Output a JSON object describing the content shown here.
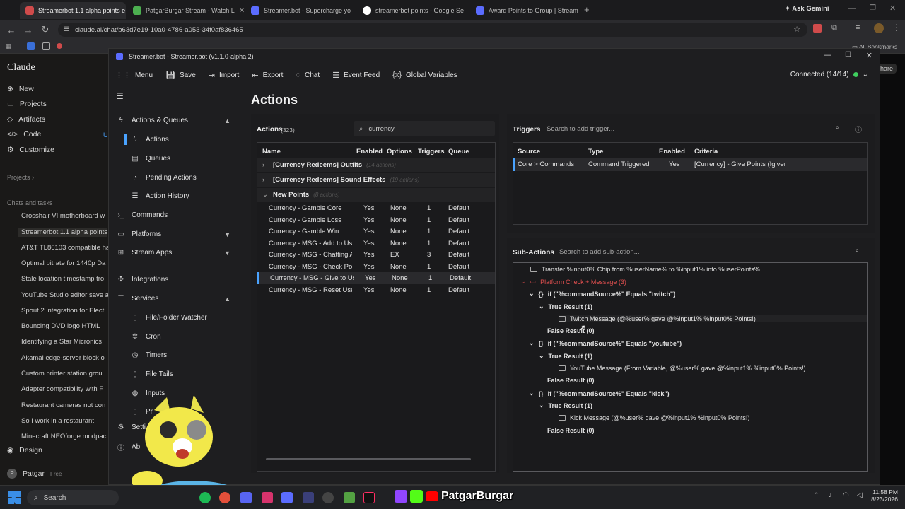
{
  "browser": {
    "tabs": [
      {
        "title": "Streamerbot 1.1 alpha points e"
      },
      {
        "title": "PatgarBurgar Stream - Watch L"
      },
      {
        "title": "Streamer.bot - Supercharge yo"
      },
      {
        "title": "streamerbot points - Google Se"
      },
      {
        "title": "Award Points to Group | Stream"
      }
    ],
    "ask_gemini": "Ask Gemini",
    "url": "claude.ai/chat/b63d7e19-10a0-4786-a053-34f0af836465",
    "all_bookmarks": "All Bookmarks"
  },
  "claude": {
    "brand": "Claude",
    "nav": {
      "new": "New",
      "projects": "Projects",
      "artifacts": "Artifacts",
      "code": "Code",
      "customize": "Customize"
    },
    "projects_header": "Projects",
    "chats_header": "Chats and tasks",
    "chats": [
      "Crosshair VI motherboard w",
      "Streamerbot 1.1 alpha points",
      "AT&T TL86103 compatible ha",
      "Optimal bitrate for 1440p Da",
      "Stale location timestamp tro",
      "YouTube Studio editor save a",
      "Spout 2 integration for Elect",
      "Bouncing DVD logo HTML",
      "Identifying a Star Micronics",
      "Akamai edge-server block o",
      "Custom printer station grou",
      "Adapter compatibility with F",
      "Restaurant cameras not con",
      "So I work in a restaurant",
      "Minecraft NEOforge modpac"
    ],
    "design": "Design",
    "user": "Patgar",
    "plan": "Free",
    "share": "hare",
    "code_badge": "U"
  },
  "sb": {
    "window_title": "Streamer.bot - Streamer.bot (v1.1.0-alpha.2)",
    "menu": {
      "menu": "Menu",
      "save": "Save",
      "import": "Import",
      "export": "Export",
      "chat": "Chat",
      "event_feed": "Event Feed",
      "global_vars": "Global Variables"
    },
    "connected": "Connected (14/14)",
    "nav": {
      "actions_queues": "Actions & Queues",
      "actions": "Actions",
      "queues": "Queues",
      "pending": "Pending Actions",
      "history": "Action History",
      "commands": "Commands",
      "platforms": "Platforms",
      "stream_apps": "Stream Apps",
      "integrations": "Integrations",
      "services": "Services",
      "file_watcher": "File/Folder Watcher",
      "cron": "Cron",
      "timers": "Timers",
      "file_tails": "File Tails",
      "inputs": "Inputs",
      "pr": "Pr",
      "settings": "Setti",
      "about": "Ab"
    },
    "page_title": "Actions",
    "actions": {
      "label": "Actions",
      "count": "(323)",
      "search_value": "currency",
      "columns": [
        "Name",
        "Enabled",
        "Options",
        "Triggers",
        "Queue"
      ],
      "groups": [
        {
          "name": "[Currency Redeems] Outfits",
          "count": "(14 actions)"
        },
        {
          "name": "[Currency Redeems] Sound Effects",
          "count": "(19 actions)"
        },
        {
          "name": "New Points",
          "count": "(8 actions)"
        }
      ],
      "rows": [
        [
          "Currency - Gamble Core",
          "Yes",
          "None",
          "1",
          "Default"
        ],
        [
          "Currency - Gamble Loss",
          "Yes",
          "None",
          "1",
          "Default"
        ],
        [
          "Currency - Gamble Win",
          "Yes",
          "None",
          "1",
          "Default"
        ],
        [
          "Currency - MSG - Add to Us",
          "Yes",
          "None",
          "1",
          "Default"
        ],
        [
          "Currency - MSG - Chatting A",
          "Yes",
          "EX",
          "3",
          "Default"
        ],
        [
          "Currency - MSG - Check Poi",
          "Yes",
          "None",
          "1",
          "Default"
        ],
        [
          "Currency - MSG - Give to Us",
          "Yes",
          "None",
          "1",
          "Default"
        ],
        [
          "Currency - MSG - Reset Use",
          "Yes",
          "None",
          "1",
          "Default"
        ]
      ]
    },
    "triggers": {
      "label": "Triggers",
      "search_placeholder": "Search to add trigger...",
      "columns": [
        "Source",
        "Type",
        "Enabled",
        "Criteria"
      ],
      "rows": [
        [
          "Core > Commands",
          "Command Triggered",
          "Yes",
          "[Currency] - Give Points (!giver"
        ]
      ]
    },
    "subactions": {
      "label": "Sub-Actions",
      "search_placeholder": "Search to add sub-action...",
      "items": [
        "Transfer %input0% Chip from %userName% to %input1% into %userPoints%",
        "Platform Check + Message (3)",
        "if (\"%commandSource%\" Equals \"twitch\")",
        "True Result (1)",
        "Twitch Message (@%user% gave @%input1% %input0% Points!)",
        "False Result (0)",
        "if (\"%commandSource%\" Equals \"youtube\")",
        "True Result (1)",
        "YouTube Message (From Variable, @%user% gave @%input1% %input0% Points!)",
        "False Result (0)",
        "if (\"%commandSource%\" Equals \"kick\")",
        "True Result (1)",
        "Kick Message (@%user% gave @%input1% %input0% Points!)",
        "False Result (0)"
      ]
    }
  },
  "taskbar": {
    "search": "Search",
    "streamer_name": "PatgarBurgar",
    "time": "11:58 PM",
    "date": "8/23/2026"
  },
  "colors": {
    "accent_blue": "#4aa3ff",
    "platform_red": "#e04f4f",
    "green": "#3fcf5e"
  }
}
